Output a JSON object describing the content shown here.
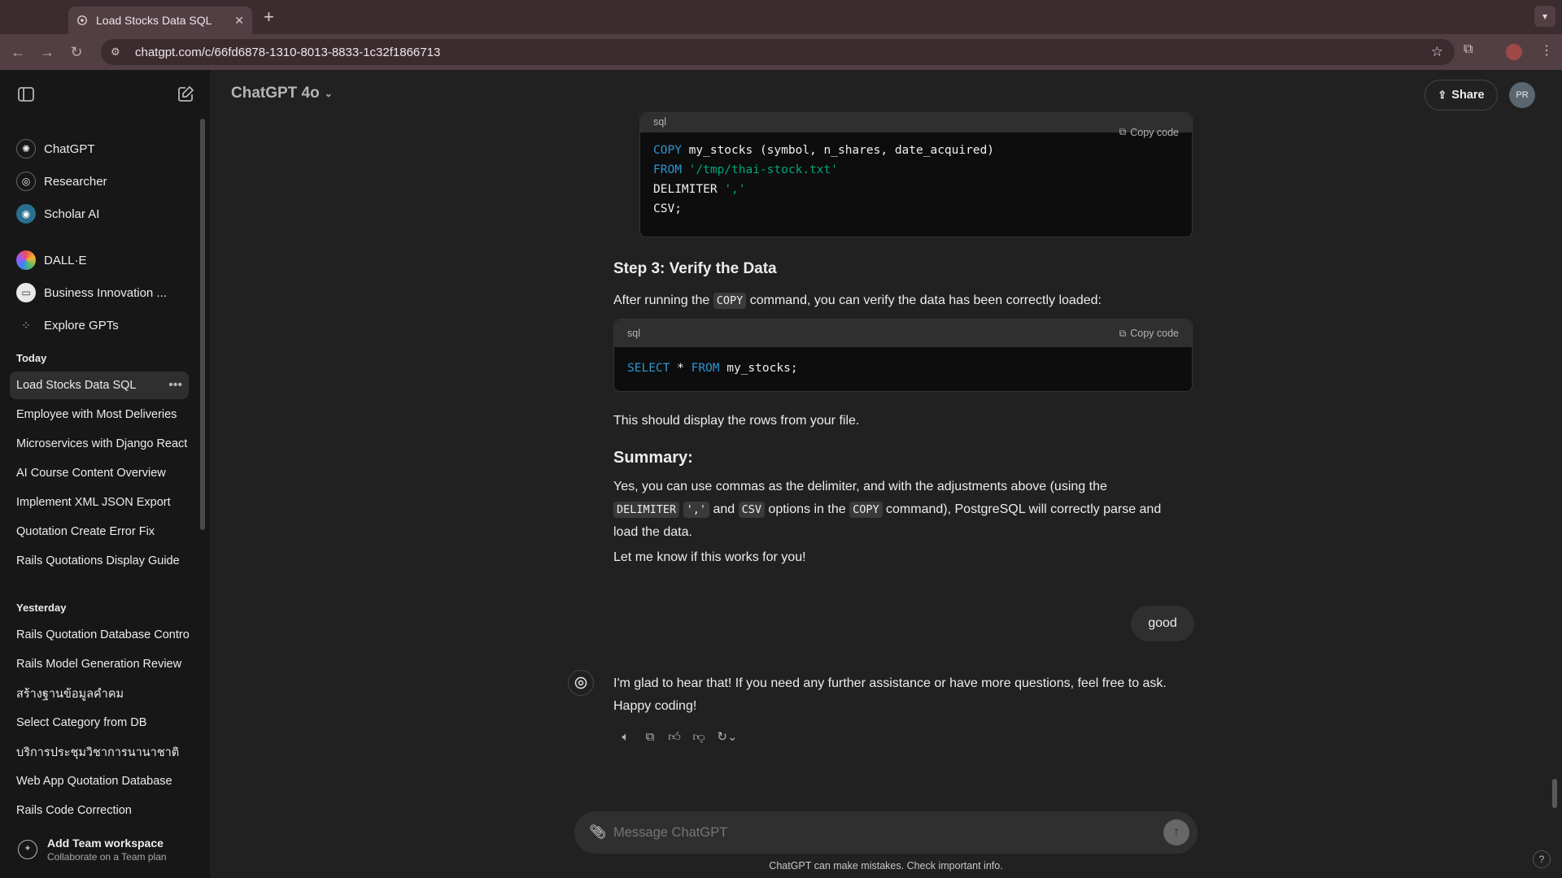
{
  "browser": {
    "tab_title": "Load Stocks Data SQL",
    "tab_close": "✕",
    "new_tab": "+",
    "url": "chatgpt.com/c/66fd6878-1310-8013-8833-1c32f1866713"
  },
  "sidebar": {
    "gpts": [
      {
        "label": "ChatGPT",
        "icon": "openai-icon"
      },
      {
        "label": "Researcher",
        "icon": "researcher-icon"
      },
      {
        "label": "Scholar AI",
        "icon": "scholar-icon"
      },
      {
        "label": "DALL·E",
        "icon": "dalle-icon"
      },
      {
        "label": "Business Innovation ...",
        "icon": "business-icon"
      },
      {
        "label": "Explore GPTs",
        "icon": "grid-icon"
      }
    ],
    "today_label": "Today",
    "today": [
      "Load Stocks Data SQL",
      "Employee with Most Deliveries",
      "Microservices with Django React",
      "AI Course Content Overview",
      "Implement XML JSON Export",
      "Quotation Create Error Fix",
      "Rails Quotations Display Guide"
    ],
    "yesterday_label": "Yesterday",
    "yesterday": [
      "Rails Quotation Database Control",
      "Rails Model Generation Review",
      "สร้างฐานข้อมูลคำคม",
      "Select Category from DB",
      "บริการประชุมวิชาการนานาชาติ",
      "Web App Quotation Database",
      "Rails Code Correction"
    ],
    "team_title": "Add Team workspace",
    "team_sub": "Collaborate on a Team plan"
  },
  "header": {
    "model": "ChatGPT 4o",
    "share": "Share",
    "avatar": "PR"
  },
  "conversation": {
    "code1": {
      "lang": "sql",
      "copy": "Copy code",
      "line1_kw": "COPY",
      "line1_rest": " my_stocks (symbol, n_shares, date_acquired)",
      "line2_kw": "FROM",
      "line2_str": "'/tmp/thai-stock.txt'",
      "line3_a": "DELIMITER ",
      "line3_str": "','",
      "line4": "CSV;"
    },
    "step3_heading": "Step 3: Verify the Data",
    "step3_p_a": "After running the ",
    "step3_p_code": "COPY",
    "step3_p_b": " command, you can verify the data has been correctly loaded:",
    "code2": {
      "lang": "sql",
      "copy": "Copy code",
      "kw1": "SELECT",
      "mid": " * ",
      "kw2": "FROM",
      "rest": " my_stocks;"
    },
    "display_text": "This should display the rows from your file.",
    "summary_heading": "Summary:",
    "summary_a": "Yes, you can use commas as the delimiter, and with the adjustments above (using the ",
    "summary_code1": "DELIMITER",
    "summary_code2": "','",
    "summary_b": " and ",
    "summary_code3": "CSV",
    "summary_c": " options in the ",
    "summary_code4": "COPY",
    "summary_d": " command), PostgreSQL will correctly parse and load the data.",
    "letmeknow": "Let me know if this works for you!",
    "user_msg": "good",
    "assistant_reply": "I'm glad to hear that! If you need any further assistance or have more questions, feel free to ask. Happy coding!"
  },
  "composer": {
    "placeholder": "Message ChatGPT",
    "disclaimer": "ChatGPT can make mistakes. Check important info."
  }
}
